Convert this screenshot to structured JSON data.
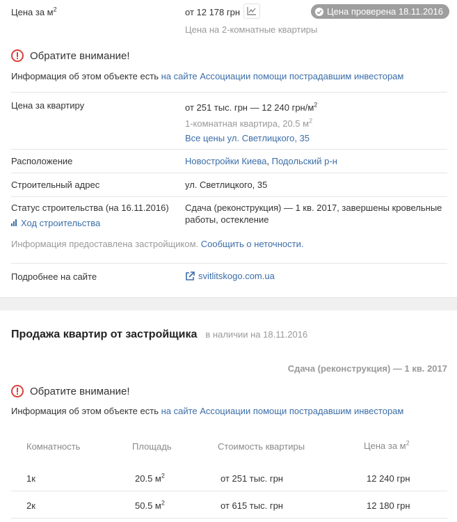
{
  "card1": {
    "price_m2_label": "Цена за м",
    "price_m2_value": "от 12 178 грн",
    "price_m2_note": "Цена на 2-комнатные квартиры",
    "verified_badge": "Цена проверена 18.11.2016",
    "warning_title": "Обратите внимание!",
    "warning_text": "Информация об этом объекте есть ",
    "warning_link": "на сайте Ассоциации помощи пострадавшим инвесторам",
    "apt_price_label": "Цена за квартиру",
    "apt_price_value": "от 251 тыс. грн — 12 240 грн/м",
    "apt_price_note": "1-комнатная квартира, 20.5 м",
    "apt_price_link": "Все цены ул. Светлицкого, 35",
    "location_label": "Расположение",
    "location_link1": "Новостройки Киева",
    "location_sep": ", ",
    "location_link2": "Подольский р-н",
    "address_label": "Строительный адрес",
    "address_value": "ул. Светлицкого, 35",
    "status_label": "Статус строительства (на 16.11.2016)",
    "status_value_line1": "Сдача (реконструкция) — 1 кв. 2017, завершены кровельные",
    "status_value_line2": "работы, остекление",
    "progress_link": "Ход строительства",
    "info_text": "Информация предоставлена застройщиком. ",
    "info_link": "Сообщить о неточности.",
    "more_label": "Подробнее на сайте",
    "more_link": "svitlitskogo.com.ua"
  },
  "card2": {
    "title": "Продажа квартир от застройщика",
    "availability": "в наличии на 18.11.2016",
    "completion": "Сдача (реконструкция) — 1 кв. 2017",
    "warning_title": "Обратите внимание!",
    "warning_text": "Информация об этом объекте есть ",
    "warning_link": "на сайте Ассоциации помощи пострадавшим инвесторам",
    "table": {
      "headers": [
        "Комнатность",
        "Площадь",
        "Стоимость квартиры",
        "Цена за м"
      ],
      "rows": [
        {
          "rooms": "1к",
          "area": "20.5 м",
          "cost": "от 251 тыс. грн",
          "price_m2": "12 240 грн"
        },
        {
          "rooms": "2к",
          "area": "50.5 м",
          "cost": "от 615 тыс. грн",
          "price_m2": "12 180 грн"
        }
      ]
    }
  },
  "sup2": "2",
  "colors": {
    "link": "#3b6ea8",
    "warning": "#d9413b",
    "badge": "#9e9e9e"
  },
  "icons": [
    "price-chart-icon",
    "check-icon",
    "warning-icon",
    "progress-bars-icon",
    "external-link-icon"
  ]
}
